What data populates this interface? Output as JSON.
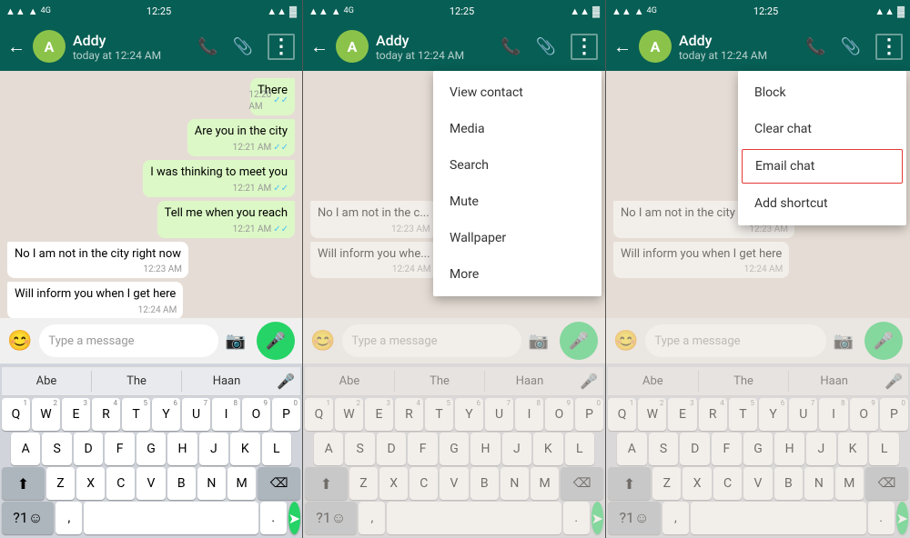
{
  "panels": [
    {
      "id": "panel1",
      "statusBar": {
        "left": [
          "signal",
          "wifi",
          "time"
        ],
        "time": "12:25",
        "right": [
          "signal2",
          "wifi2",
          "battery"
        ]
      },
      "appBar": {
        "contactName": "Addy",
        "contactStatus": "today at 12:24 AM",
        "avatarLetter": "A"
      },
      "messages": [
        {
          "type": "out",
          "text": "There",
          "time": "12:20 AM",
          "checks": "✓✓"
        },
        {
          "type": "out",
          "text": "Are you in the city",
          "time": "12:21 AM",
          "checks": "✓✓"
        },
        {
          "type": "out",
          "text": "I was thinking to meet you",
          "time": "12:21 AM",
          "checks": "✓✓"
        },
        {
          "type": "out",
          "text": "Tell me when you reach",
          "time": "12:21 AM",
          "checks": "✓✓"
        },
        {
          "type": "in",
          "text": "No I am not in the city right now",
          "time": "12:23 AM"
        },
        {
          "type": "in",
          "text": "Will inform you when I get here",
          "time": "12:24 AM"
        }
      ],
      "inputPlaceholder": "Type a message",
      "keyboard": {
        "suggestions": [
          "Abe",
          "The",
          "Haan"
        ],
        "rows": [
          [
            "Q",
            "W",
            "E",
            "R",
            "T",
            "Y",
            "U",
            "I",
            "O",
            "P"
          ],
          [
            "A",
            "S",
            "D",
            "F",
            "G",
            "H",
            "J",
            "K",
            "L"
          ],
          [
            "Z",
            "X",
            "C",
            "V",
            "B",
            "N",
            "M"
          ],
          [
            "?1☺",
            ",",
            "",
            ".",
            ""
          ]
        ],
        "nums": [
          "1",
          "2",
          "3",
          "4",
          "5",
          "6",
          "7",
          "8",
          "9",
          "0",
          "",
          "",
          "",
          "",
          "",
          "",
          "",
          "",
          "",
          "",
          "",
          "",
          "",
          "",
          "",
          "",
          "",
          "",
          ""
        ]
      }
    },
    {
      "id": "panel2",
      "dropdown": {
        "items": [
          "View contact",
          "Media",
          "Search",
          "Mute",
          "Wallpaper",
          "More"
        ]
      }
    },
    {
      "id": "panel3",
      "dropdown": {
        "items": [
          "Block",
          "Clear chat",
          "Email chat",
          "Add shortcut"
        ],
        "highlighted": "Email chat"
      }
    }
  ],
  "icons": {
    "back": "←",
    "phone": "📞",
    "attachment": "📎",
    "more": "⋮",
    "emoji": "😊",
    "camera": "📷",
    "mic": "🎤",
    "send": "➤",
    "shift": "⬆",
    "delete": "⌫",
    "micKey": "🎤"
  }
}
